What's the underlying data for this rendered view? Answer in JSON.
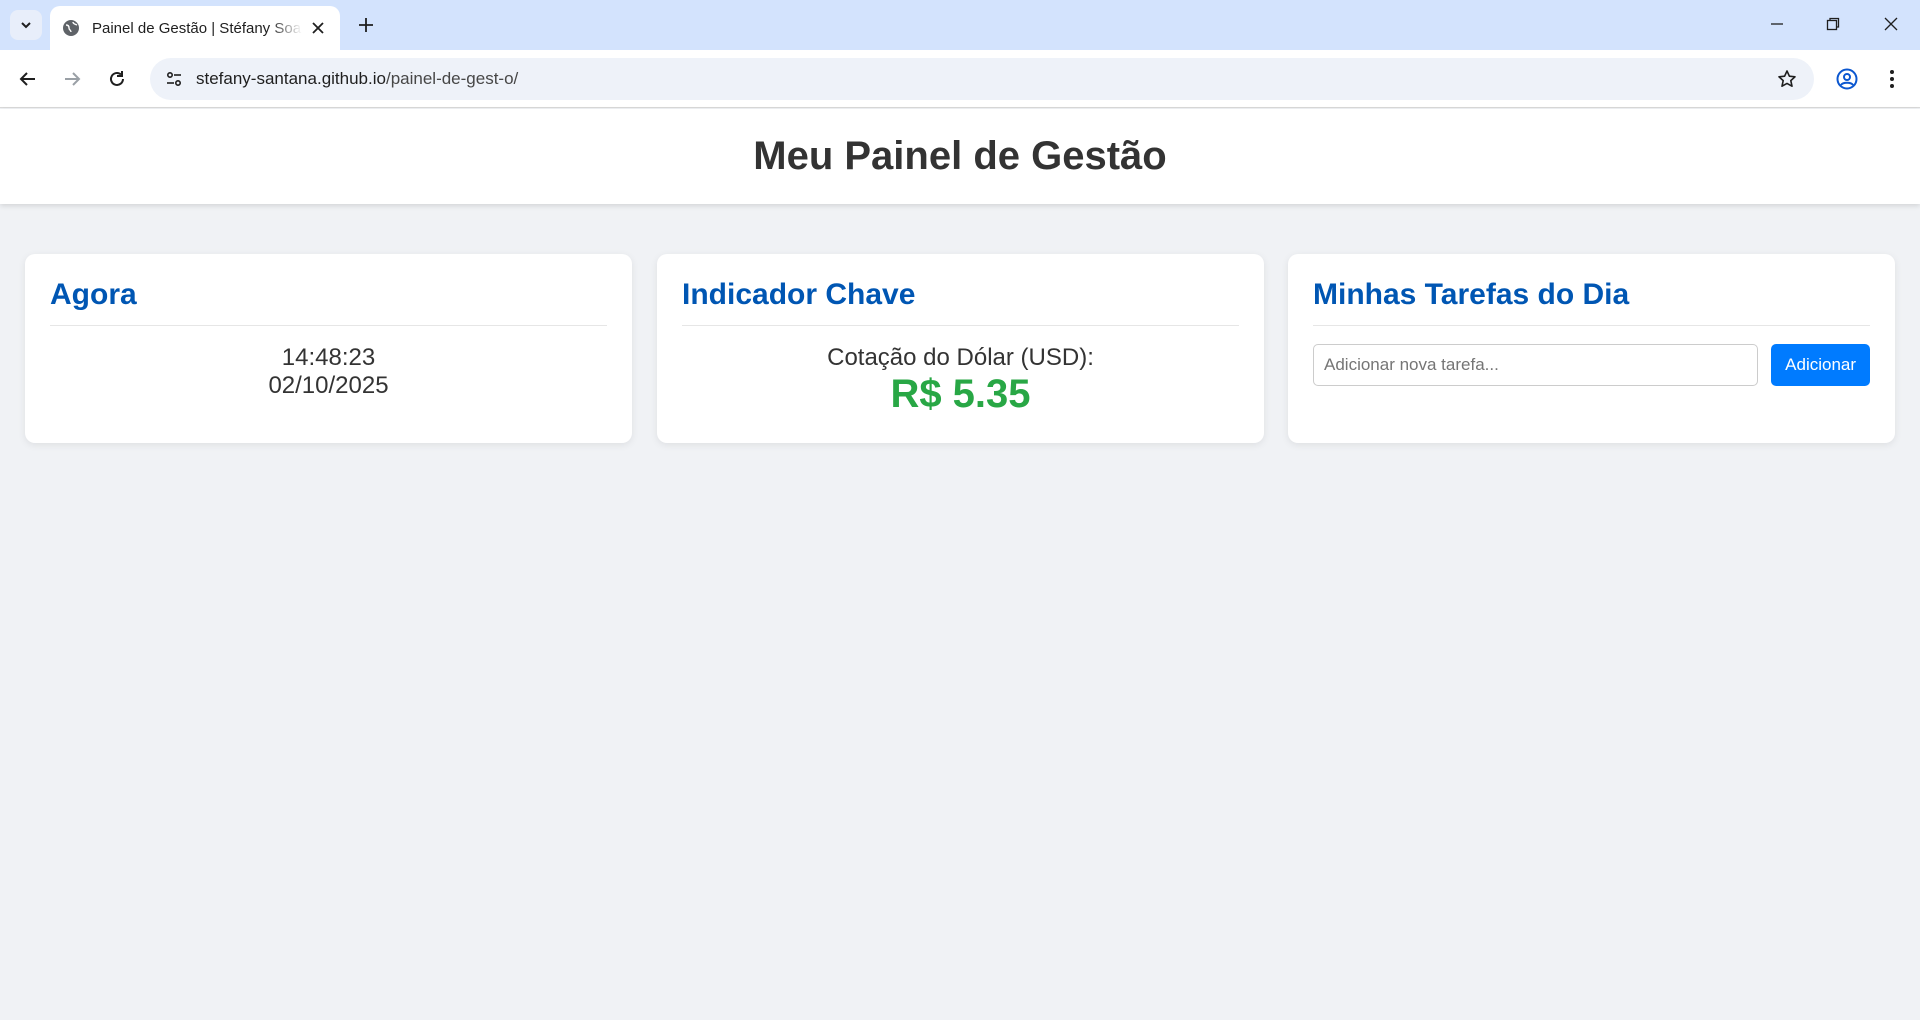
{
  "browser": {
    "tab_title": "Painel de Gestão | Stéfany Soares",
    "url_host": "stefany-santana.github.io",
    "url_path": "/painel-de-gest-o/",
    "icons": [
      "chevron-down-icon",
      "globe-icon",
      "close-icon",
      "plus-icon",
      "minimize-icon",
      "restore-icon",
      "back-icon",
      "forward-icon",
      "reload-icon",
      "site-info-icon",
      "star-icon",
      "account-icon",
      "more-icon"
    ]
  },
  "header": {
    "title": "Meu Painel de Gestão"
  },
  "clock_card": {
    "title": "Agora",
    "time": "14:48:23",
    "date": "02/10/2025"
  },
  "indicator_card": {
    "title": "Indicador Chave",
    "label": "Cotação do Dólar (USD):",
    "value": "R$ 5.35"
  },
  "tasks_card": {
    "title": "Minhas Tarefas do Dia",
    "input_placeholder": "Adicionar nova tarefa...",
    "add_label": "Adicionar"
  },
  "colors": {
    "accent": "#0056b3",
    "success": "#28a745",
    "button": "#007bff",
    "background": "#f0f2f5"
  }
}
